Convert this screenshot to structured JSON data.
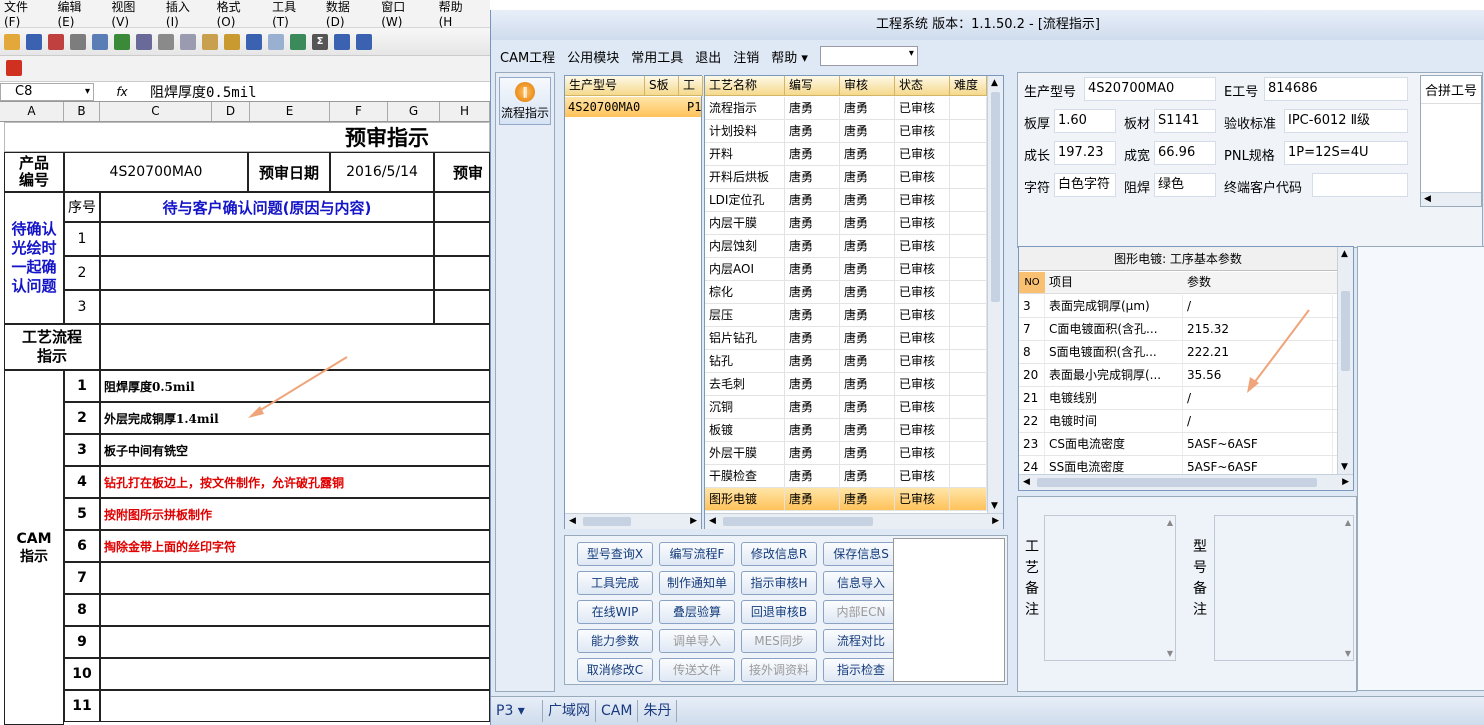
{
  "excel": {
    "menu": [
      "文件(F)",
      "编辑(E)",
      "视图(V)",
      "插入(I)",
      "格式(O)",
      "工具(T)",
      "数据(D)",
      "窗口(W)",
      "帮助(H"
    ],
    "name_box": "C8",
    "fx_label": "fx",
    "formula": "阻焊厚度0.5mil",
    "columns": [
      "A",
      "B",
      "C",
      "D",
      "E",
      "F",
      "G",
      "H"
    ],
    "sheet_title": "预审指示",
    "product_no_label": "产品\n编号",
    "product_no": "4S20700MA0",
    "review_date_label": "预审日期",
    "review_date": "2016/5/14",
    "review_trunc": "预审",
    "confirm_label": "待确认光绘时一起确认问题",
    "seq_header": "序号",
    "issue_header": "待与客户确认问题(原因与内容)",
    "confirm_rows": [
      "1",
      "2",
      "3"
    ],
    "flow_label": "工艺流程\n指示",
    "cam_label": "CAM\n指示",
    "cam_rows": [
      {
        "no": "1",
        "text": "阻焊厚度0.5mil",
        "red": false
      },
      {
        "no": "2",
        "text": "外层完成铜厚1.4mil",
        "red": false
      },
      {
        "no": "3",
        "text": "板子中间有铣空",
        "red": false
      },
      {
        "no": "4",
        "text": "钻孔打在板边上，按文件制作，允许破孔露铜",
        "red": true
      },
      {
        "no": "5",
        "text": "按附图所示拼板制作",
        "red": true
      },
      {
        "no": "6",
        "text": "掏除金带上面的丝印字符",
        "red": true
      },
      {
        "no": "7",
        "text": "",
        "red": false
      },
      {
        "no": "8",
        "text": "",
        "red": false
      },
      {
        "no": "9",
        "text": "",
        "red": false
      },
      {
        "no": "10",
        "text": "",
        "red": false
      },
      {
        "no": "11",
        "text": "",
        "red": false
      }
    ]
  },
  "app": {
    "title": "工程系统  版本：1.1.50.2 - [流程指示]",
    "menu": [
      "CAM工程",
      "公用模块",
      "常用工具",
      "退出",
      "注销",
      "帮助 ▾"
    ],
    "nav_button": "流程指示",
    "left_grid": {
      "headers": [
        "生产型号",
        "S板",
        "工"
      ],
      "rows": [
        [
          "4S20700MA0",
          "",
          "P1"
        ]
      ]
    },
    "process_grid": {
      "headers": [
        "工艺名称",
        "编写",
        "审核",
        "状态",
        "难度"
      ],
      "rows": [
        [
          "流程指示",
          "唐勇",
          "唐勇",
          "已审核"
        ],
        [
          "计划投料",
          "唐勇",
          "唐勇",
          "已审核"
        ],
        [
          "开料",
          "唐勇",
          "唐勇",
          "已审核"
        ],
        [
          "开料后烘板",
          "唐勇",
          "唐勇",
          "已审核"
        ],
        [
          "LDI定位孔",
          "唐勇",
          "唐勇",
          "已审核"
        ],
        [
          "内层干膜",
          "唐勇",
          "唐勇",
          "已审核"
        ],
        [
          "内层蚀刻",
          "唐勇",
          "唐勇",
          "已审核"
        ],
        [
          "内层AOI",
          "唐勇",
          "唐勇",
          "已审核"
        ],
        [
          "棕化",
          "唐勇",
          "唐勇",
          "已审核"
        ],
        [
          "层压",
          "唐勇",
          "唐勇",
          "已审核"
        ],
        [
          "铝片钻孔",
          "唐勇",
          "唐勇",
          "已审核"
        ],
        [
          "钻孔",
          "唐勇",
          "唐勇",
          "已审核"
        ],
        [
          "去毛刺",
          "唐勇",
          "唐勇",
          "已审核"
        ],
        [
          "沉铜",
          "唐勇",
          "唐勇",
          "已审核"
        ],
        [
          "板镀",
          "唐勇",
          "唐勇",
          "已审核"
        ],
        [
          "外层干膜",
          "唐勇",
          "唐勇",
          "已审核"
        ],
        [
          "干膜检查",
          "唐勇",
          "唐勇",
          "已审核"
        ],
        [
          "图形电镀",
          "唐勇",
          "唐勇",
          "已审核"
        ]
      ],
      "selected_index": 17
    },
    "buttons": [
      {
        "label": "型号查询X",
        "enabled": true
      },
      {
        "label": "编写流程F",
        "enabled": true
      },
      {
        "label": "修改信息R",
        "enabled": true
      },
      {
        "label": "保存信息S",
        "enabled": true
      },
      {
        "label": "工具完成",
        "enabled": true
      },
      {
        "label": "制作通知单",
        "enabled": true
      },
      {
        "label": "指示审核H",
        "enabled": true
      },
      {
        "label": "信息导入",
        "enabled": true
      },
      {
        "label": "在线WIP",
        "enabled": true
      },
      {
        "label": "叠层验算",
        "enabled": true
      },
      {
        "label": "回退审核B",
        "enabled": true
      },
      {
        "label": "内部ECN",
        "enabled": false
      },
      {
        "label": "能力参数",
        "enabled": true
      },
      {
        "label": "调单导入",
        "enabled": false
      },
      {
        "label": "MES同步",
        "enabled": false
      },
      {
        "label": "流程对比",
        "enabled": true
      },
      {
        "label": "取消修改C",
        "enabled": true
      },
      {
        "label": "传送文件",
        "enabled": false
      },
      {
        "label": "接外调资料",
        "enabled": false
      },
      {
        "label": "指示检查",
        "enabled": true
      }
    ],
    "info": {
      "model_label": "生产型号",
      "model": "4S20700MA0",
      "eno_label": "E工号",
      "eno": "814686",
      "thick_label": "板厚",
      "thick": "1.60",
      "mat_label": "板材",
      "mat": "S1141",
      "std_label": "验收标准",
      "std": "IPC-6012 Ⅱ级",
      "len_label": "成长",
      "len": "197.23",
      "wid_label": "成宽",
      "wid": "66.96",
      "pnl_label": "PNL规格",
      "pnl": "1P=12S=4U",
      "char_label": "字符",
      "char": "白色字符",
      "mask_label": "阻焊",
      "mask": "绿色",
      "cust_label": "终端客户代码",
      "cust": "",
      "combined_label": "合拼工号"
    },
    "params": {
      "title": "图形电镀: 工序基本参数",
      "headers": [
        "NO",
        "项目",
        "参数"
      ],
      "rows": [
        [
          "3",
          "表面完成铜厚(μm)",
          "/"
        ],
        [
          "7",
          "C面电镀面积(含孔...",
          "215.32"
        ],
        [
          "8",
          "S面电镀面积(含孔...",
          "222.21"
        ],
        [
          "20",
          "表面最小完成铜厚(...",
          "35.56"
        ],
        [
          "21",
          "电镀线别",
          "/"
        ],
        [
          "22",
          "电镀时间",
          "/"
        ],
        [
          "23",
          "CS面电流密度",
          "5ASF~6ASF"
        ],
        [
          "24",
          "SS面电流密度",
          "5ASF~6ASF"
        ]
      ]
    },
    "notes": {
      "proc_label": "工艺备注",
      "model_label": "型号备注"
    },
    "status": [
      "P3 ▾",
      "广域网",
      "CAM",
      "朱丹"
    ]
  }
}
